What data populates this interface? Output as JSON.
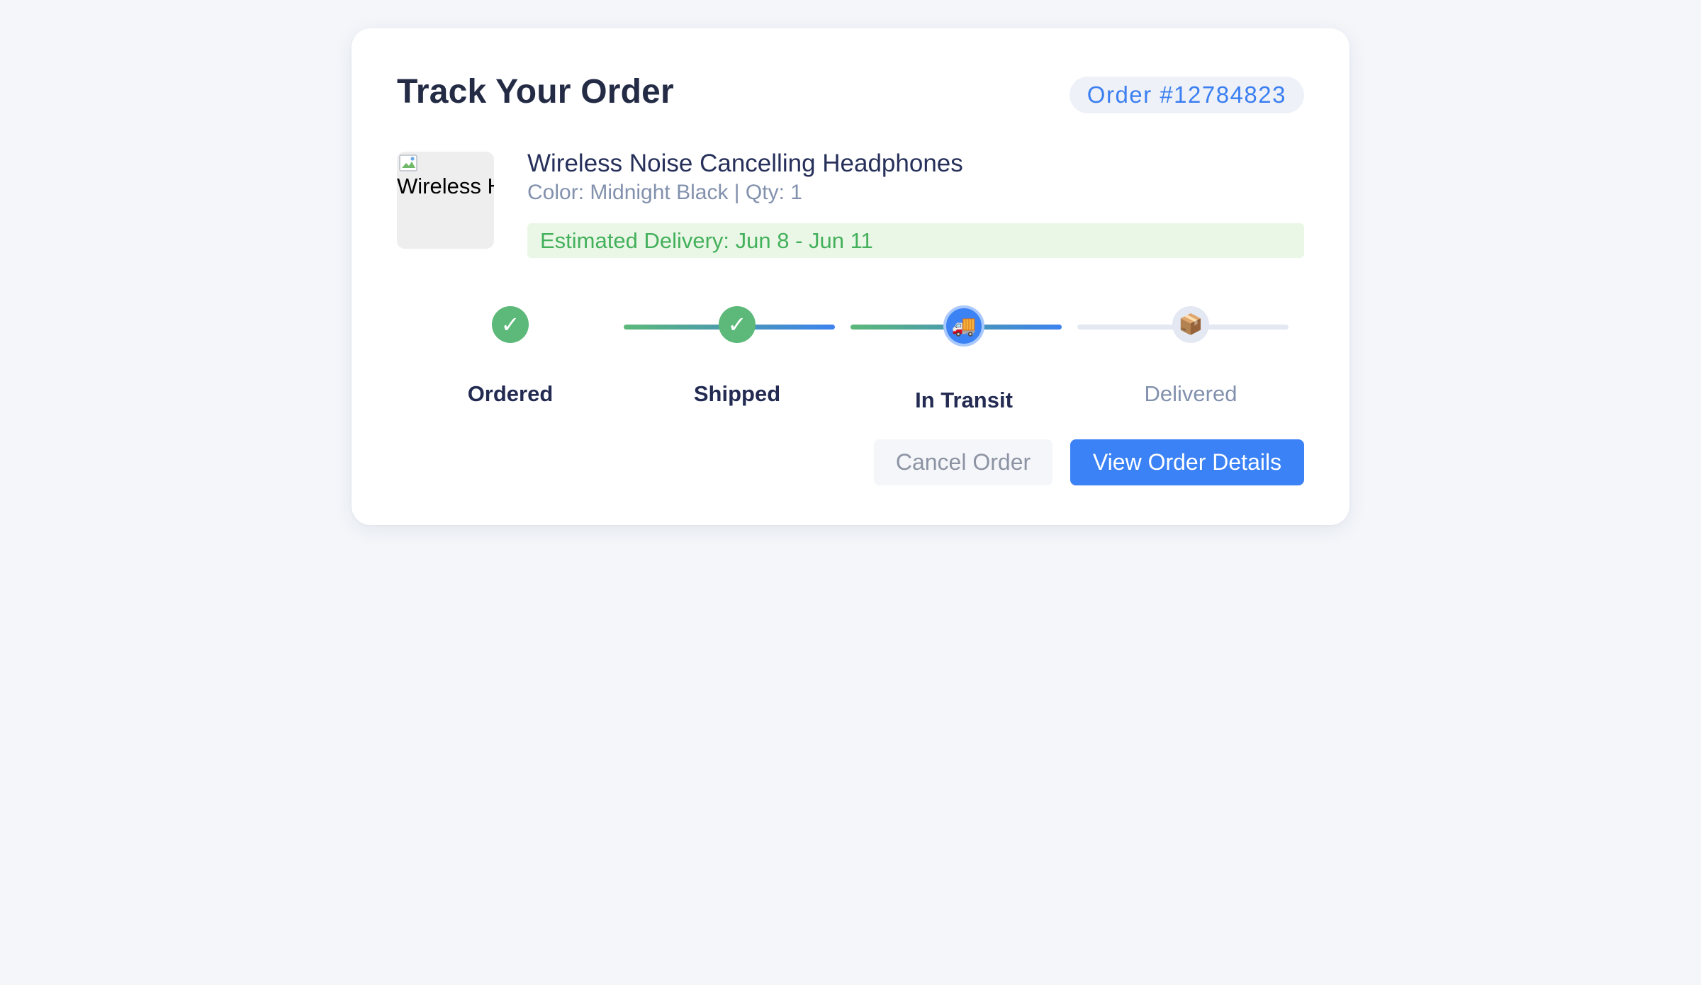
{
  "header": {
    "title": "Track Your Order",
    "order_number": "Order #12784823"
  },
  "product": {
    "image_alt": "Wireless Headphones",
    "name": "Wireless Noise Cancelling Headphones",
    "meta": "Color: Midnight Black | Qty: 1",
    "estimated_delivery": "Estimated Delivery: Jun 8 - Jun 11"
  },
  "progress": {
    "steps": [
      {
        "label": "Ordered",
        "state": "done",
        "icon": "check-icon",
        "glyph": "✓"
      },
      {
        "label": "Shipped",
        "state": "done",
        "icon": "check-icon",
        "glyph": "✓"
      },
      {
        "label": "In Transit",
        "state": "current",
        "icon": "truck-icon",
        "glyph": "🚚"
      },
      {
        "label": "Delivered",
        "state": "pending",
        "icon": "package-icon",
        "glyph": "📦"
      }
    ]
  },
  "actions": {
    "cancel_label": "Cancel Order",
    "view_label": "View Order Details"
  },
  "colors": {
    "accent": "#3b82f6",
    "success": "#5cb979",
    "title": "#232b45",
    "muted": "#8291ad"
  }
}
